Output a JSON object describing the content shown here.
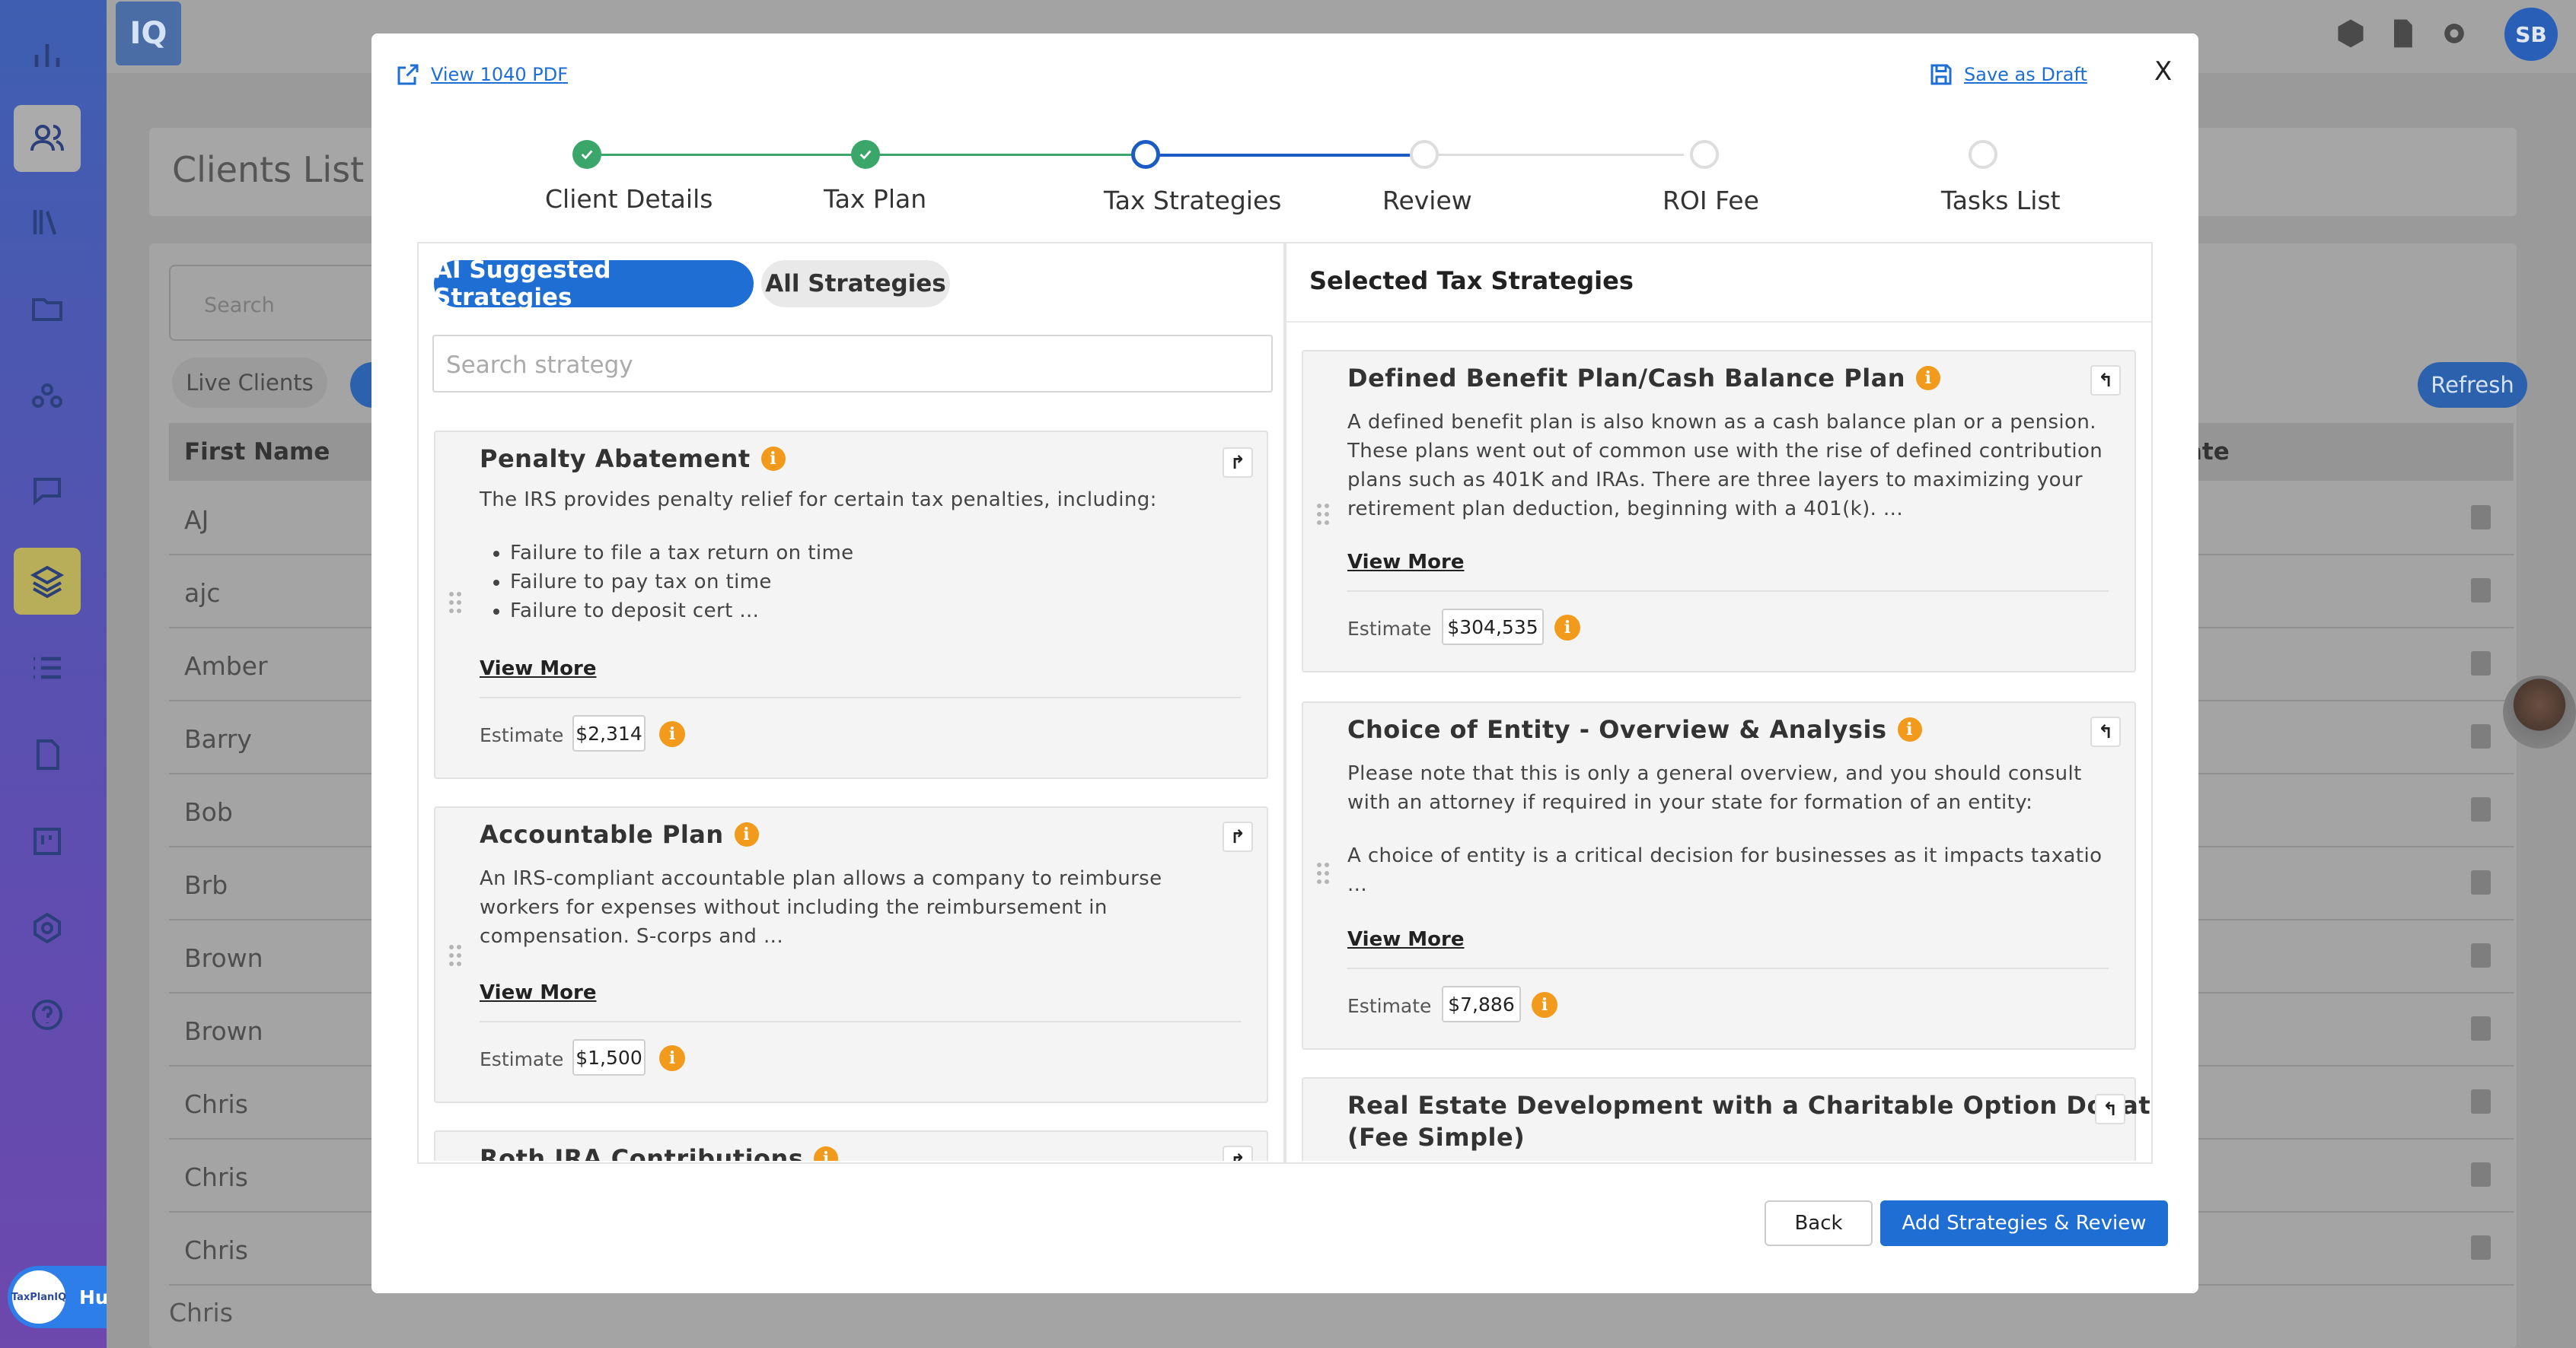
{
  "background": {
    "page_title": "Clients List",
    "search_placeholder": "Search",
    "live_clients_chip": "Live Clients",
    "refresh_button": "Refresh",
    "table_headers": {
      "first_name": "First Name",
      "date": "ate"
    },
    "rows": [
      "AJ",
      "ajc",
      "Amber",
      "Barry",
      "Bob",
      "Brb",
      "Brown",
      "Brown",
      "Chris",
      "Chris",
      "Chris"
    ],
    "partial_row": "Chris",
    "user_initials": "SB",
    "hub_label": "Hub",
    "hub_logo_text": "TaxPlanIQ",
    "app_logo": "IQ"
  },
  "modal": {
    "view_pdf_link": "View 1040 PDF",
    "save_draft_link": "Save as Draft",
    "close_label": "X",
    "steps": [
      {
        "label": "Client Details",
        "state": "done"
      },
      {
        "label": "Tax Plan",
        "state": "done"
      },
      {
        "label": "Tax Strategies",
        "state": "current"
      },
      {
        "label": "Review",
        "state": "todo"
      },
      {
        "label": "ROI Fee",
        "state": "todo"
      },
      {
        "label": "Tasks List",
        "state": "todo"
      }
    ],
    "tabs": {
      "ai": "AI Suggested Strategies",
      "all": "All Strategies"
    },
    "search_placeholder": "Search strategy",
    "right_title": "Selected Tax Strategies",
    "estimate_label": "Estimate",
    "view_more": "View More",
    "left_cards": [
      {
        "title": "Penalty Abatement",
        "desc": "The IRS provides penalty relief for certain tax penalties, including:",
        "bullets": [
          "Failure to file a tax return on time",
          "Failure to pay tax on time",
          "Failure to deposit cert ..."
        ],
        "estimate": "$2,314"
      },
      {
        "title": "Accountable Plan",
        "desc": "An IRS-compliant accountable plan allows a company to reimburse workers for expenses without including the reimbursement in compensation. S-corps and ...",
        "estimate": "$1,500"
      },
      {
        "title": "Roth IRA Contributions"
      }
    ],
    "right_cards": [
      {
        "title": "Defined Benefit Plan/Cash Balance Plan",
        "desc": "A defined benefit plan is also known as a cash balance plan or a pension. These plans went out of common use with the rise of defined contribution plans such as 401K and IRAs. There are three layers to maximizing your retirement plan deduction, beginning with a 401(k). ...",
        "estimate": "$304,535"
      },
      {
        "title": "Choice of Entity - Overview & Analysis",
        "desc1": "Please note that this is only a general overview, and you should consult with an attorney if required in your state for formation of an entity:",
        "desc2": "A choice of entity is a critical decision for businesses as it impacts taxatio ...",
        "estimate": "$7,886"
      },
      {
        "title_line1": "Real Estate Development with a Charitable Option Donation",
        "title_line2": "(Fee Simple)"
      }
    ],
    "back_button": "Back",
    "add_button": "Add Strategies & Review"
  },
  "colors": {
    "accent": "#1f6ed4",
    "done": "#3aa66a",
    "info": "#f29a1b"
  }
}
